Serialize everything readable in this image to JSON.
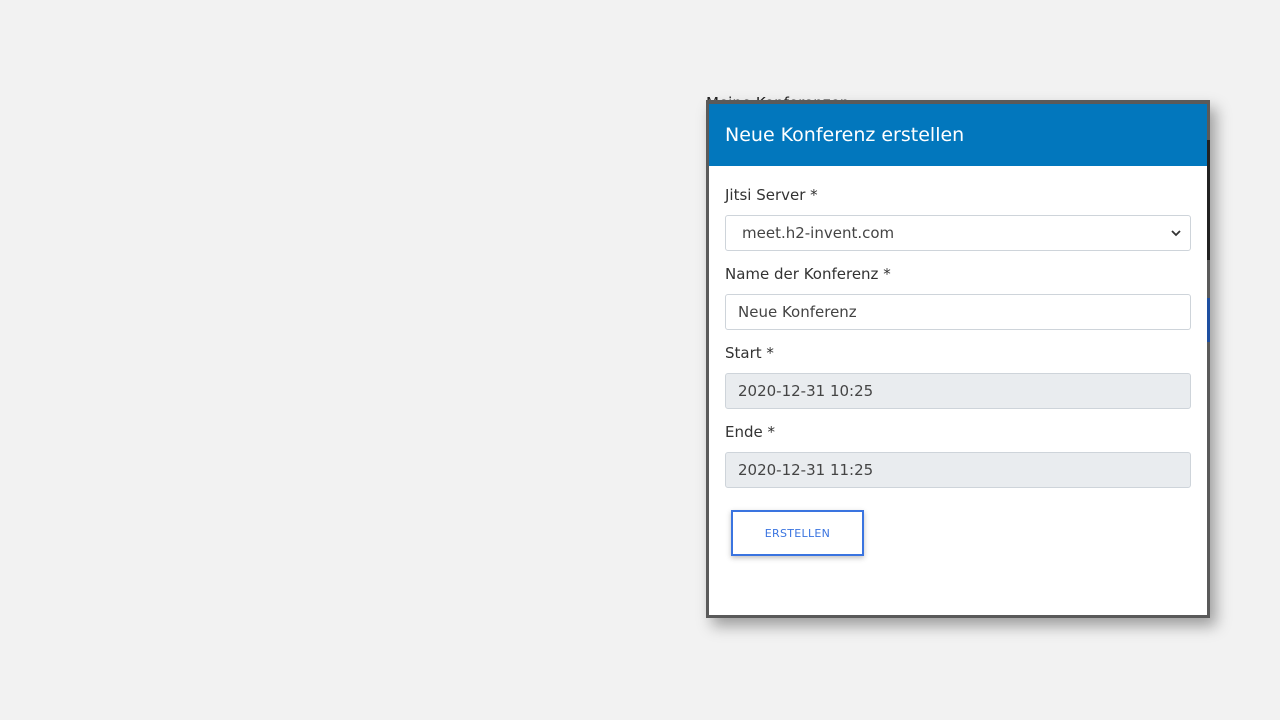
{
  "background": {
    "partial_heading": "Meine Konferenzen"
  },
  "modal": {
    "title": "Neue Konferenz erstellen",
    "fields": {
      "server": {
        "label": "Jitsi Server *",
        "value": "meet.h2-invent.com"
      },
      "name": {
        "label": "Name der Konferenz *",
        "value": "Neue Konferenz"
      },
      "start": {
        "label": "Start *",
        "value": "2020-12-31 10:25"
      },
      "end": {
        "label": "Ende *",
        "value": "2020-12-31 11:25"
      }
    },
    "submit_label": "ERSTELLEN"
  },
  "colors": {
    "header": "#0277bd",
    "button_accent": "#3a74e0",
    "readonly_bg": "#e9ecef"
  },
  "icons": {
    "select_arrow": "chevron-down-icon"
  }
}
